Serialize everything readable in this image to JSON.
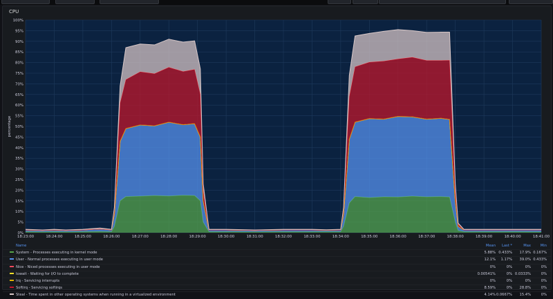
{
  "panel": {
    "title": "CPU"
  },
  "colors": {
    "background": "#111217",
    "plot_bg": "#0b2240",
    "grid": "#1f3a5c"
  },
  "legend": {
    "headers": {
      "name": "Name",
      "mean": "Mean",
      "last": "Last *",
      "max": "Max",
      "min": "Min"
    },
    "rows": [
      {
        "name": "System - Processes executing in kernel mode",
        "color": "#56a64b",
        "mean": "5.88%",
        "last": "0.433%",
        "max": "17.9%",
        "min": "0.167%"
      },
      {
        "name": "User - Normal processes executing in user mode",
        "color": "#5794f2",
        "mean": "12.1%",
        "last": "1.17%",
        "max": "39.0%",
        "min": "0.433%"
      },
      {
        "name": "Nice - Niced processes executing in user mode",
        "color": "#f2495c",
        "mean": "0%",
        "last": "0%",
        "max": "0%",
        "min": "0%"
      },
      {
        "name": "Iowait - Waiting for I/O to complete",
        "color": "#fade2a",
        "mean": "0.00541%",
        "last": "0%",
        "max": "0.0333%",
        "min": "0%"
      },
      {
        "name": "Irq - Servicing interrupts",
        "color": "#e0b400",
        "mean": "0%",
        "last": "0%",
        "max": "0%",
        "min": "0%"
      },
      {
        "name": "Softirq - Servicing softirqs",
        "color": "#c4162a",
        "mean": "8.59%",
        "last": "0%",
        "max": "28.8%",
        "min": "0%"
      },
      {
        "name": "Steal - Time spent in other operating systems when running in a virtualized environment",
        "color": "#d9c8c8",
        "mean": "4.14%",
        "last": "0.0667%",
        "max": "15.4%",
        "min": "0%"
      }
    ]
  },
  "chart_data": {
    "type": "area",
    "ylabel": "percentage",
    "ylim": [
      0,
      100
    ],
    "y_ticks": [
      "0%",
      "5%",
      "10%",
      "15%",
      "20%",
      "25%",
      "30%",
      "35%",
      "40%",
      "45%",
      "50%",
      "55%",
      "60%",
      "65%",
      "70%",
      "75%",
      "80%",
      "85%",
      "90%",
      "95%",
      "100%"
    ],
    "x_ticks": [
      "18:23:00",
      "18:24:00",
      "18:25:00",
      "18:26:00",
      "18:27:00",
      "18:28:00",
      "18:29:00",
      "18:30:00",
      "18:31:00",
      "18:32:00",
      "18:33:00",
      "18:34:00",
      "18:35:00",
      "18:36:00",
      "18:37:00",
      "18:38:00",
      "18:39:00",
      "18:40:00",
      "18:41:00"
    ],
    "x": [
      0,
      0.6,
      1.0,
      1.4,
      2.0,
      2.6,
      3.0,
      3.1,
      3.3,
      3.5,
      4.0,
      4.5,
      5.0,
      5.5,
      5.9,
      6.1,
      6.2,
      6.4,
      7.0,
      8.0,
      9.0,
      9.5,
      10.0,
      10.5,
      11.0,
      11.1,
      11.3,
      11.5,
      12.0,
      12.5,
      13.0,
      13.5,
      14.0,
      14.5,
      14.8,
      15.0,
      15.1,
      15.3,
      16.0,
      17.0,
      18.0
    ],
    "stacked": true,
    "series": [
      {
        "name": "System - Processes executing in kernel mode",
        "color": "#56a64b",
        "values": [
          0.5,
          0.4,
          0.5,
          0.4,
          0.5,
          0.6,
          0.5,
          3,
          15,
          17,
          17.2,
          17.5,
          17.3,
          17.6,
          17.5,
          15,
          5,
          0.5,
          0.5,
          0.4,
          0.5,
          0.5,
          0.5,
          0.5,
          0.5,
          3,
          14,
          17,
          16.5,
          16.9,
          16.8,
          17.2,
          16.9,
          17,
          16.8,
          5,
          1,
          0.5,
          0.5,
          0.5,
          0.4
        ]
      },
      {
        "name": "User - Normal processes executing in user mode",
        "color": "#5794f2",
        "values": [
          0.8,
          0.7,
          0.8,
          0.7,
          0.8,
          1.2,
          0.8,
          6,
          28,
          32,
          33.5,
          32.8,
          34.7,
          33.2,
          33.8,
          30,
          10,
          0.8,
          0.8,
          0.7,
          0.8,
          0.8,
          0.8,
          0.7,
          0.8,
          6,
          30,
          35,
          37.2,
          36.5,
          37.9,
          37.3,
          36.5,
          36.8,
          36.5,
          10,
          2,
          0.8,
          0.8,
          0.8,
          0.9
        ]
      },
      {
        "name": "Nice - Niced processes executing in user mode",
        "color": "#f2495c",
        "values": [
          0,
          0,
          0,
          0,
          0,
          0,
          0,
          0,
          0,
          0,
          0,
          0,
          0,
          0,
          0,
          0,
          0,
          0,
          0,
          0,
          0,
          0,
          0,
          0,
          0,
          0,
          0,
          0,
          0,
          0,
          0,
          0,
          0,
          0,
          0,
          0,
          0,
          0,
          0,
          0,
          0
        ]
      },
      {
        "name": "Iowait - Waiting for I/O to complete",
        "color": "#fade2a",
        "values": [
          0,
          0,
          0,
          0,
          0,
          0,
          0,
          0,
          0,
          0,
          0,
          0,
          0,
          0,
          0,
          0,
          0,
          0,
          0,
          0,
          0,
          0,
          0,
          0,
          0,
          0,
          0,
          0,
          0,
          0,
          0,
          0,
          0,
          0,
          0,
          0,
          0,
          0,
          0,
          0,
          0
        ]
      },
      {
        "name": "Irq - Servicing interrupts",
        "color": "#e0b400",
        "values": [
          0,
          0,
          0,
          0,
          0,
          0,
          0,
          0,
          0,
          0,
          0,
          0,
          0,
          0,
          0,
          0,
          0,
          0,
          0,
          0,
          0,
          0,
          0,
          0,
          0,
          0,
          0,
          0,
          0,
          0,
          0,
          0,
          0,
          0,
          0,
          0,
          0,
          0,
          0,
          0,
          0
        ]
      },
      {
        "name": "Softirq - Servicing softirqs",
        "color": "#c4162a",
        "values": [
          0,
          0,
          0,
          0,
          0,
          0,
          0,
          2,
          18,
          23,
          25,
          24.5,
          25.8,
          25,
          25.5,
          20,
          5,
          0,
          0,
          0,
          0,
          0,
          0,
          0,
          0,
          2,
          20,
          26,
          26.5,
          27.3,
          27,
          28,
          27.6,
          27.2,
          27.8,
          5,
          1,
          0,
          0,
          0,
          0
        ]
      },
      {
        "name": "Steal - Time spent in other operating systems when running in a virtualized environment",
        "color": "#d9c8c8",
        "values": [
          0.3,
          0.2,
          0.3,
          0.2,
          0.3,
          0.4,
          0.3,
          1,
          8,
          15,
          13,
          13.5,
          13.2,
          13.8,
          13.4,
          12,
          3,
          0.3,
          0.3,
          0.2,
          0.3,
          0.3,
          0.3,
          0.2,
          0.3,
          1,
          10,
          14.5,
          13.5,
          14,
          13.8,
          12.5,
          13.2,
          13.3,
          13.2,
          3,
          0.5,
          0.3,
          0.3,
          0.3,
          0.3
        ]
      }
    ]
  }
}
